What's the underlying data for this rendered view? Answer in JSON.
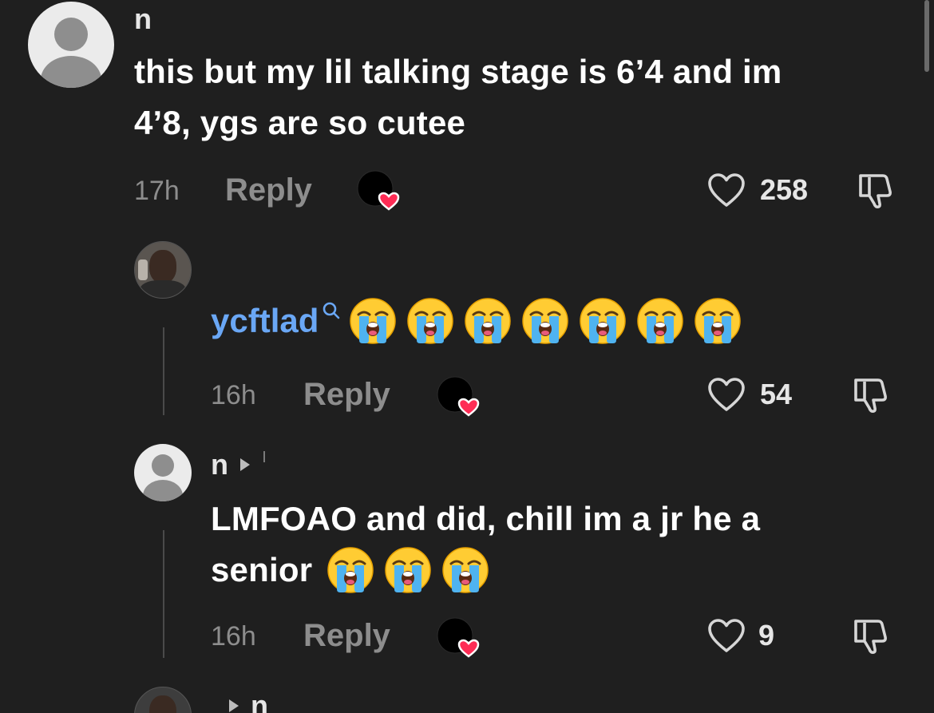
{
  "comments": [
    {
      "username": "n",
      "text_line1": "this but my lil talking stage is 6’4 and im",
      "text_line2": "4’8, ygs are so cutee",
      "time": "17h",
      "reply_label": "Reply",
      "likes": "258"
    },
    {
      "username": "ycftlad",
      "emoji_count": 7,
      "time": "16h",
      "reply_label": "Reply",
      "likes": "54"
    },
    {
      "username": "n",
      "text_line1": "LMFOAO and did, chill im a jr he a",
      "text_line2": "senior",
      "emoji_count": 3,
      "time": "16h",
      "reply_label": "Reply",
      "likes": "9"
    },
    {
      "username": "n"
    }
  ],
  "colors": {
    "background": "#1f1f1f",
    "creator_name": "#6aa7f5",
    "heart_badge": "#fe2c55",
    "muted_text": "#8d8d8d"
  },
  "icons": {
    "like": "heart-outline-icon",
    "dislike": "thumbs-down-icon",
    "creator_liked": "creator-heart-badge-icon",
    "creator_search": "search-icon",
    "reply_to": "play-triangle-icon",
    "emoji": "loudly-crying-face-emoji"
  }
}
